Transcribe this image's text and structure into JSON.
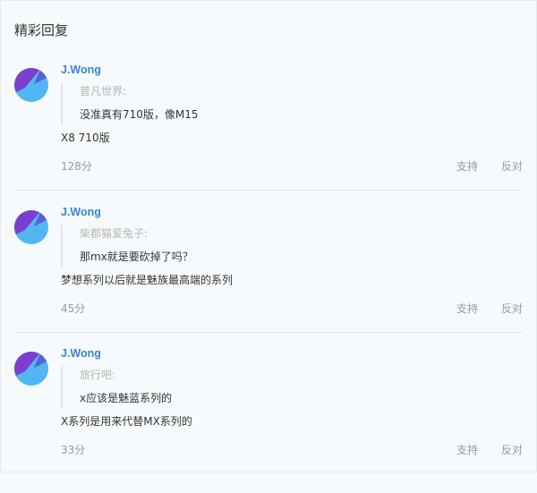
{
  "section": {
    "title": "精彩回复"
  },
  "comments": [
    {
      "username": "J.Wong",
      "quote_author": "普凡世界:",
      "quote_text": "没准真有710版，像M15",
      "reply": "X8 710版",
      "likes": "128分",
      "support_label": "支持",
      "oppose_label": "反对"
    },
    {
      "username": "J.Wong",
      "quote_author": "柴郡猫爱兔子:",
      "quote_text": "那mx就是要砍掉了吗？",
      "reply": "梦想系列以后就是魅族最高端的系列",
      "likes": "45分",
      "support_label": "支持",
      "oppose_label": "反对"
    },
    {
      "username": "J.Wong",
      "quote_author": "旅行吧:",
      "quote_text": "x应该是魅蓝系列的",
      "reply": "X系列是用来代替MX系列的",
      "likes": "33分",
      "support_label": "支持",
      "oppose_label": "反对"
    }
  ],
  "colors": {
    "username": "#3a86c8",
    "muted": "#999999",
    "avatar_purple": "#7b3fd0",
    "avatar_blue": "#52b6f2"
  },
  "icons": {
    "avatar": "avatar-icon"
  }
}
